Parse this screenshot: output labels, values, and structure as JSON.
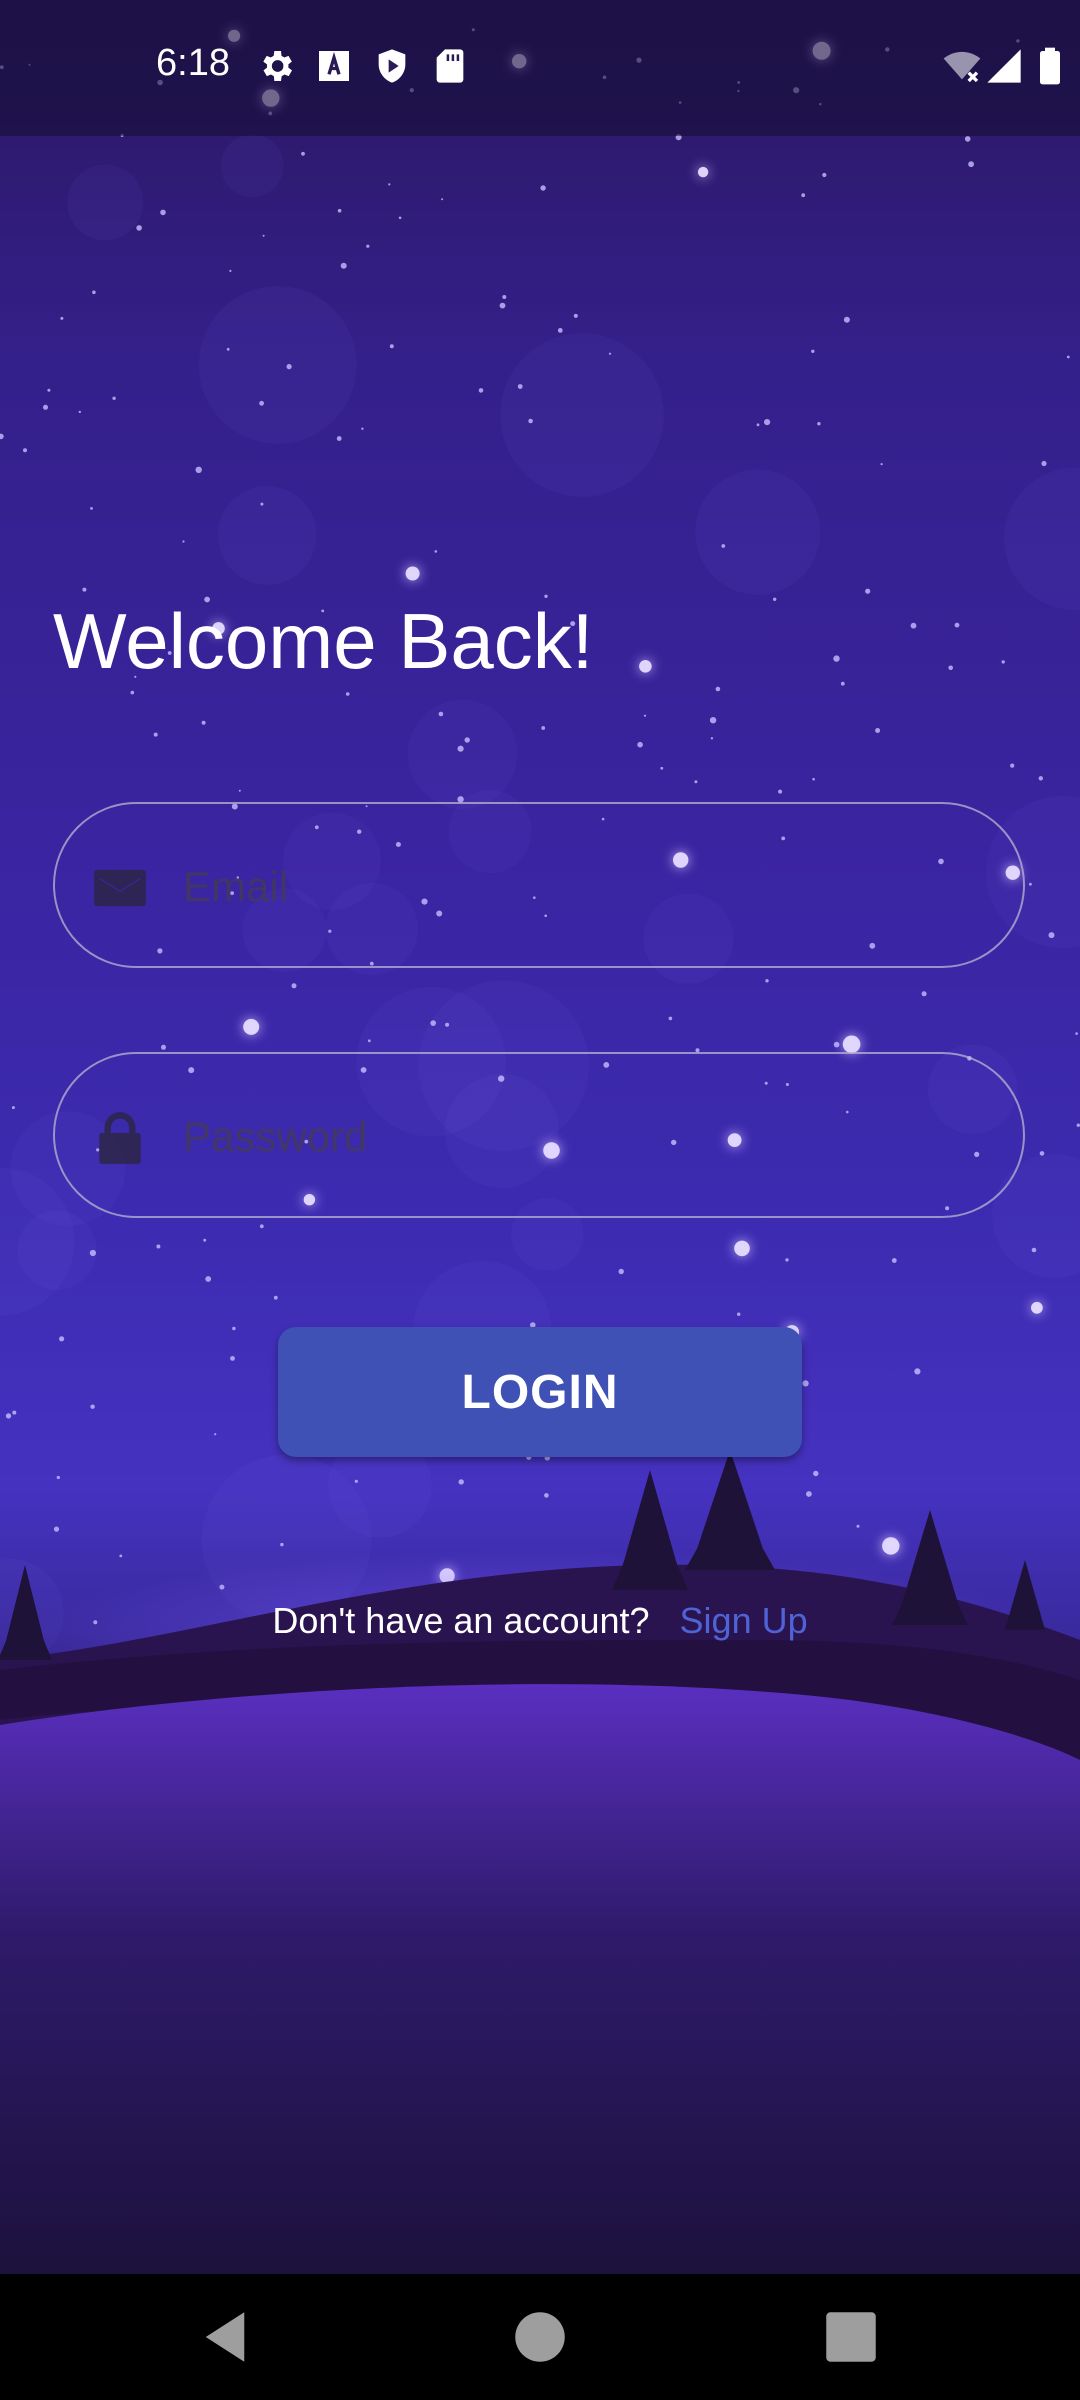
{
  "status_bar": {
    "time": "6:18",
    "left_icons": [
      "gear-icon",
      "text-a-icon",
      "shield-play-icon",
      "sd-card-icon"
    ],
    "right_icons": [
      "wifi-off-icon",
      "signal-icon",
      "battery-icon"
    ]
  },
  "login": {
    "title": "Welcome Back!",
    "email_placeholder": "Email",
    "email_value": "",
    "password_placeholder": "Password",
    "password_value": "",
    "login_label": "LOGIN",
    "signup_prompt": "Don't have an account?",
    "signup_link": "Sign Up"
  },
  "nav_bar": {
    "buttons": [
      "back-icon",
      "home-icon",
      "recents-icon"
    ]
  },
  "colors": {
    "accent": "#3f51b5",
    "link": "#4f63d6",
    "background_top": "#2a1760",
    "background_bottom": "#150e2c"
  }
}
